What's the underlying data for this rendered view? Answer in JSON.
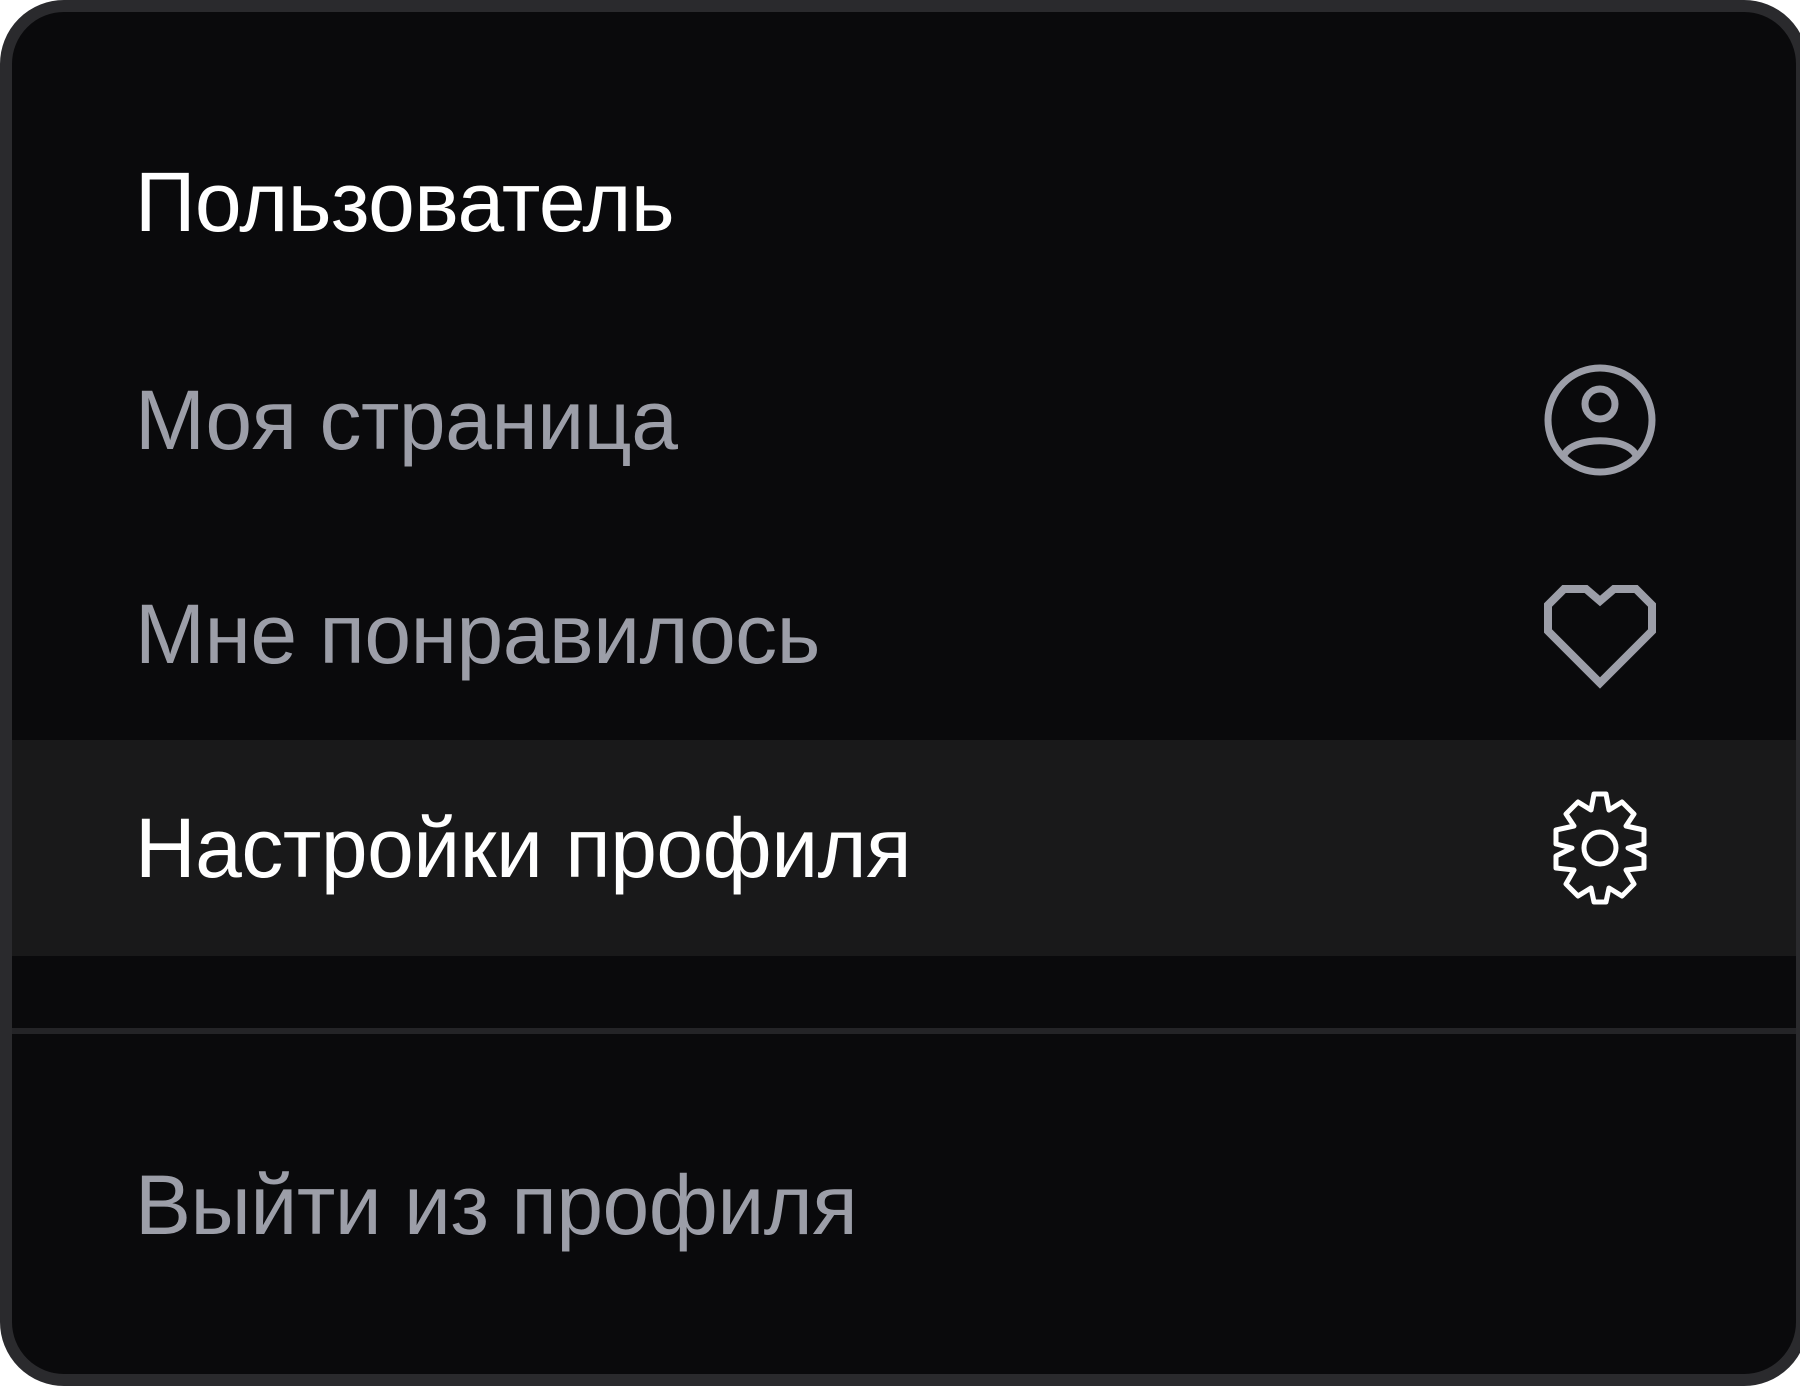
{
  "menu": {
    "header": "Пользователь",
    "items": [
      {
        "label": "Моя страница",
        "icon": "user-circle-icon",
        "active": false
      },
      {
        "label": "Мне понравилось",
        "icon": "heart-icon",
        "active": false
      },
      {
        "label": "Настройки профиля",
        "icon": "gear-icon",
        "active": true
      }
    ],
    "logout_label": "Выйти из профиля"
  },
  "colors": {
    "background": "#0a0a0c",
    "border": "#2a2a2d",
    "active_row": "#19191a",
    "text_primary": "#ffffff",
    "text_secondary": "#9c9ea8",
    "divider": "#242427"
  }
}
